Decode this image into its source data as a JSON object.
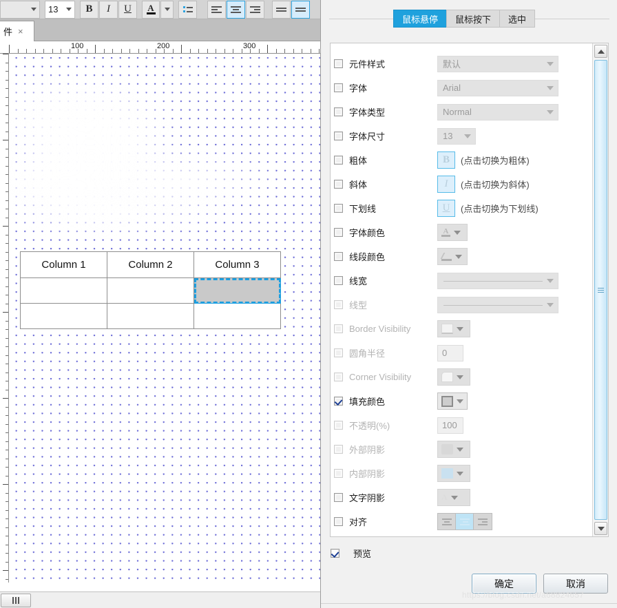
{
  "toolbar": {
    "font_family_value": "",
    "font_size_value": "13",
    "bold_icon": "bold-icon",
    "italic_icon": "italic-icon",
    "underline_icon": "underline-icon",
    "font_color_icon": "font-color-icon",
    "bullet_list_icon": "bullet-list-icon",
    "align_left_icon": "align-left-icon",
    "align_center_icon": "align-center-icon",
    "align_right_icon": "align-right-icon",
    "valign_top_icon": "valign-top-icon",
    "valign_middle_icon": "valign-middle-icon"
  },
  "tab": {
    "label": "件",
    "close": "×"
  },
  "ruler": {
    "labels": [
      "100",
      "200",
      "300"
    ],
    "label_positions": [
      101,
      226,
      351
    ]
  },
  "canvas": {
    "table": {
      "headers": [
        "Column 1",
        "Column 2",
        "Column 3"
      ],
      "rows": [
        [
          "",
          "",
          ""
        ],
        [
          "",
          "",
          ""
        ]
      ],
      "selected_cell": {
        "row": 0,
        "col": 2
      }
    }
  },
  "hscroll": {
    "thumb_icon": "scroll-grip-icon"
  },
  "dialog": {
    "tabs": [
      {
        "label": "鼠标悬停",
        "active": true
      },
      {
        "label": "鼠标按下",
        "active": false
      },
      {
        "label": "选中",
        "active": false
      }
    ],
    "rows": [
      {
        "label": "元件样式",
        "checked": false,
        "enabled": true,
        "control": "select-wide",
        "value": "默认",
        "name": "widget-style"
      },
      {
        "label": "字体",
        "checked": false,
        "enabled": true,
        "control": "select-wide",
        "value": "Arial",
        "name": "font-family"
      },
      {
        "label": "字体类型",
        "checked": false,
        "enabled": true,
        "control": "select-wide",
        "value": "Normal",
        "name": "font-style"
      },
      {
        "label": "字体尺寸",
        "checked": false,
        "enabled": true,
        "control": "select-narrow",
        "value": "13",
        "name": "font-size"
      },
      {
        "label": "粗体",
        "checked": false,
        "enabled": true,
        "control": "toggle-bold",
        "value": "B",
        "hint": "(点击切换为粗体)",
        "name": "bold"
      },
      {
        "label": "斜体",
        "checked": false,
        "enabled": true,
        "control": "toggle-italic",
        "value": "I",
        "hint": "(点击切换为斜体)",
        "name": "italic"
      },
      {
        "label": "下划线",
        "checked": false,
        "enabled": true,
        "control": "toggle-underline",
        "value": "U",
        "hint": "(点击切换为下划线)",
        "name": "underline"
      },
      {
        "label": "字体颜色",
        "checked": false,
        "enabled": true,
        "control": "swatch-font",
        "value": "",
        "name": "font-color"
      },
      {
        "label": "线段颜色",
        "checked": false,
        "enabled": true,
        "control": "swatch-line",
        "value": "",
        "name": "line-color"
      },
      {
        "label": "线宽",
        "checked": false,
        "enabled": true,
        "control": "select-line",
        "value": "",
        "name": "line-width"
      },
      {
        "label": "线型",
        "checked": false,
        "enabled": false,
        "control": "select-line",
        "value": "",
        "name": "line-type"
      },
      {
        "label": "Border Visibility",
        "checked": false,
        "enabled": false,
        "control": "swatch-border",
        "value": "",
        "name": "border-visibility"
      },
      {
        "label": "圆角半径",
        "checked": false,
        "enabled": false,
        "control": "number",
        "value": "0",
        "name": "corner-radius"
      },
      {
        "label": "Corner Visibility",
        "checked": false,
        "enabled": false,
        "control": "swatch-corner",
        "value": "",
        "name": "corner-visibility"
      },
      {
        "label": "填充颜色",
        "checked": true,
        "enabled": true,
        "control": "swatch-fill",
        "value": "",
        "name": "fill-color"
      },
      {
        "label": "不透明(%)",
        "checked": false,
        "enabled": false,
        "control": "number",
        "value": "100",
        "name": "opacity"
      },
      {
        "label": "外部阴影",
        "checked": false,
        "enabled": false,
        "control": "swatch-outer",
        "value": "",
        "name": "outer-shadow"
      },
      {
        "label": "内部阴影",
        "checked": false,
        "enabled": false,
        "control": "swatch-inner",
        "value": "",
        "name": "inner-shadow"
      },
      {
        "label": "文字阴影",
        "checked": false,
        "enabled": true,
        "control": "swatch-text",
        "value": "",
        "name": "text-shadow"
      },
      {
        "label": "对齐",
        "checked": false,
        "enabled": true,
        "control": "align-group",
        "value": "center",
        "name": "alignment"
      }
    ],
    "preview": {
      "label": "预览",
      "checked": true
    },
    "buttons": {
      "ok": "确定",
      "cancel": "取消"
    }
  },
  "watermark": "https://blog.csdn.net/a68824657",
  "colors": {
    "accent": "#1fa1dd",
    "selection_border": "#1e9fe0",
    "selection_fill": "#c9c9c9",
    "toggle_border": "#55bbe8",
    "toggle_bg": "#ddeffb",
    "dialog_bg": "#f1f1f1"
  }
}
